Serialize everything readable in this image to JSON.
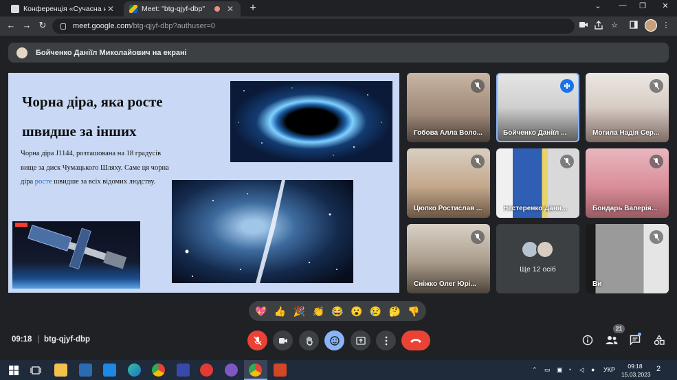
{
  "browser": {
    "tabs": [
      {
        "title": "Конференція «Сучасна науков",
        "close": "✕"
      },
      {
        "title": "Meet: \"btg-qjyf-dbp\"",
        "close": "✕"
      }
    ],
    "new_tab": "+",
    "window": {
      "dropdown": "⌄",
      "minimize": "—",
      "maximize": "❐",
      "close": "✕"
    },
    "url_host": "meet.google.com",
    "url_path": "/btg-qjyf-dbp?authuser=0"
  },
  "presentation_banner": "Бойченко Даніїл Миколайович на екрані",
  "slide": {
    "title_line1": "Чорна діра, яка росте",
    "title_line2": "швидше за інших",
    "body_before": "Чорна діра J1144, розташована на 18 градусів вище за диск Чумацького Шляху. Саме ця чорна діра ",
    "body_highlight": "росте",
    "body_after": " швидше за всіх відомих людству."
  },
  "participants": [
    {
      "name": "Гобова Алла Воло...",
      "muted": true
    },
    {
      "name": "Бойченко Даніїл ...",
      "muted": false,
      "speaking": true
    },
    {
      "name": "Могила Надія Сер...",
      "muted": true
    },
    {
      "name": "Цюпко Ростислав ...",
      "muted": true
    },
    {
      "name": "Нестеренко Дани...",
      "muted": true
    },
    {
      "name": "Бондарь Валерія...",
      "muted": true
    },
    {
      "name": "Сніжко Олег Юрі...",
      "muted": true
    },
    {
      "name": "Ще 12 осіб"
    },
    {
      "name": "Ви",
      "muted": true
    }
  ],
  "reactions": [
    "💖",
    "👍",
    "🎉",
    "👏",
    "😂",
    "😮",
    "😢",
    "🤔",
    "👎"
  ],
  "meeting": {
    "time": "09:18",
    "separator": "|",
    "code": "btg-qjyf-dbp"
  },
  "people_count": "21",
  "taskbar": {
    "lang": "УКР",
    "time": "09:18",
    "date": "15.03.2023",
    "notifications": "2"
  },
  "colors": {
    "background": "#202124",
    "surface": "#3c4043",
    "accent": "#8ab4f8",
    "danger": "#ea4335",
    "slide_bg": "#c9d9f5"
  }
}
